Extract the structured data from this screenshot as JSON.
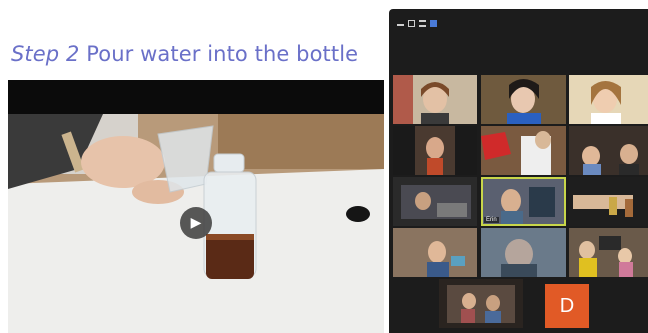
{
  "slide": {
    "title_step": "Step 2",
    "title_text": "Pour water into the bottle"
  },
  "video": {
    "play_icon": "play-icon",
    "play_glyph": "▶"
  },
  "gallery": {
    "toolbar_icons": [
      "minimize-icon",
      "maximize-icon",
      "list-view-icon",
      "grid-view-icon"
    ],
    "tiles": [
      {
        "name": ""
      },
      {
        "name": ""
      },
      {
        "name": ""
      },
      {
        "name": ""
      },
      {
        "name": ""
      },
      {
        "name": ""
      },
      {
        "name": ""
      },
      {
        "name": "Erin"
      },
      {
        "name": ""
      },
      {
        "name": ""
      },
      {
        "name": ""
      },
      {
        "name": ""
      },
      {
        "name": ""
      }
    ],
    "avatar_initial": "D",
    "avatar_color": "#e15a26",
    "active_tile_color": "#c8d64a"
  }
}
